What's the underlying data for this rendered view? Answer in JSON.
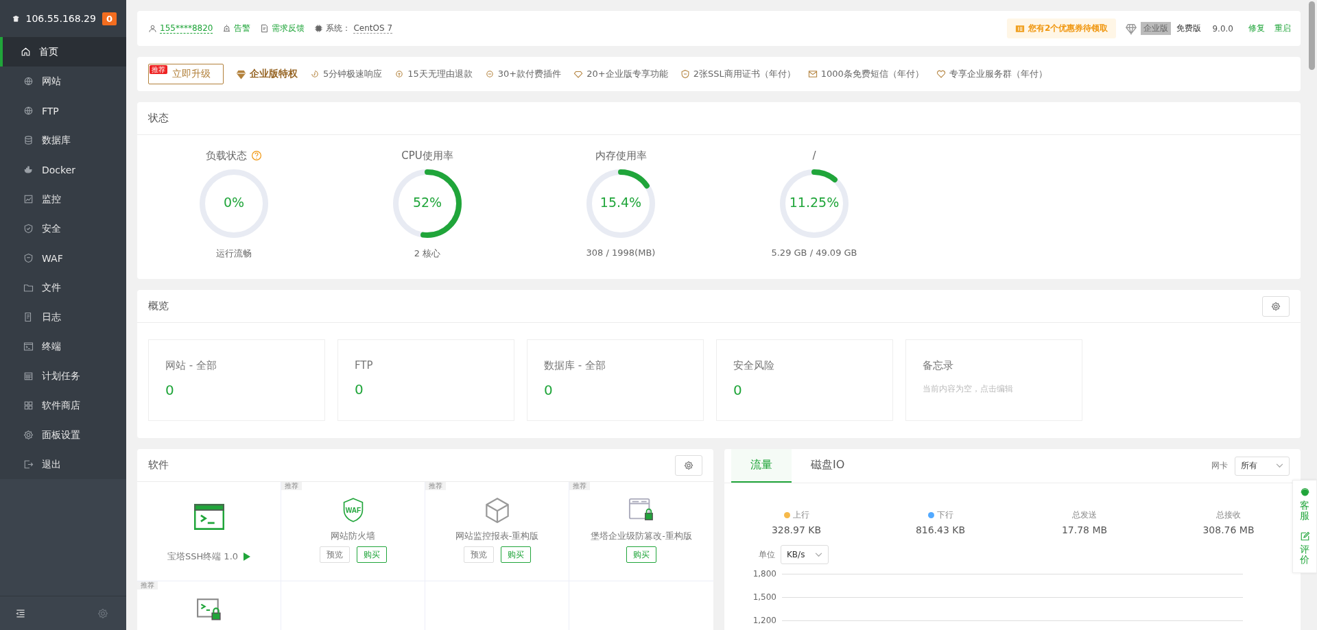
{
  "sidebar": {
    "host": "106.55.168.29",
    "badge": "0",
    "items": [
      {
        "label": "首页",
        "selected": true
      },
      {
        "label": "网站",
        "selected": false
      },
      {
        "label": "FTP",
        "selected": false
      },
      {
        "label": "数据库",
        "selected": false
      },
      {
        "label": "Docker",
        "selected": false
      },
      {
        "label": "监控",
        "selected": false
      },
      {
        "label": "安全",
        "selected": false
      },
      {
        "label": "WAF",
        "selected": false
      },
      {
        "label": "文件",
        "selected": false
      },
      {
        "label": "日志",
        "selected": false
      },
      {
        "label": "终端",
        "selected": false
      },
      {
        "label": "计划任务",
        "selected": false
      },
      {
        "label": "软件商店",
        "selected": false
      },
      {
        "label": "面板设置",
        "selected": false
      },
      {
        "label": "退出",
        "selected": false
      }
    ]
  },
  "topbar": {
    "left": [
      {
        "kind": "user",
        "text": "155****8820"
      },
      {
        "kind": "link",
        "text": "告警"
      },
      {
        "kind": "link",
        "text": "需求反馈"
      },
      {
        "kind": "system",
        "label": "系统：",
        "text": "CentOS 7"
      }
    ],
    "coupon": "您有2个优惠券待领取",
    "edition_tag": "企业版",
    "edition": "免费版",
    "version": "9.0.0",
    "actions": [
      "修复",
      "重启"
    ]
  },
  "features": {
    "upgrade": {
      "label": "立即升级",
      "ribbon": "推荐"
    },
    "title": "企业版特权",
    "items": [
      "5分钟极速响应",
      "15天无理由退款",
      "30+款付费插件",
      "20+企业版专享功能",
      "2张SSL商用证书（年付）",
      "1000条免费短信（年付）",
      "专享企业服务群（年付）"
    ]
  },
  "status": {
    "title": "状态",
    "gauges": [
      {
        "title": "负载状态",
        "help": true,
        "value": "0%",
        "level": 0,
        "caption": "运行流畅"
      },
      {
        "title": "CPU使用率",
        "help": false,
        "value": "52%",
        "level": 0.52,
        "caption": "2 核心"
      },
      {
        "title": "内存使用率",
        "help": false,
        "value": "15.4%",
        "level": 0.154,
        "caption": "308 / 1998(MB)"
      },
      {
        "title": "/",
        "help": false,
        "value": "11.25%",
        "level": 0.1125,
        "caption": "5.29 GB / 49.09 GB"
      }
    ]
  },
  "overview": {
    "title": "概览",
    "cards": [
      {
        "kind": "count",
        "label": "网站 - 全部",
        "value": "0"
      },
      {
        "kind": "count",
        "label": "FTP",
        "value": "0"
      },
      {
        "kind": "count",
        "label": "数据库 - 全部",
        "value": "0"
      },
      {
        "kind": "count",
        "label": "安全风险",
        "value": "0"
      },
      {
        "kind": "memo",
        "label": "备忘录",
        "value": "当前内容为空，点击编辑"
      }
    ]
  },
  "software": {
    "title": "软件",
    "tiles": [
      {
        "kind": "installed",
        "name": "宝塔SSH终端 1.0"
      },
      {
        "kind": "store",
        "tag": "推荐",
        "icon_text": "WAF",
        "name": "网站防火墙",
        "buttons": [
          {
            "kind": "preview",
            "label": "预览"
          },
          {
            "kind": "buy",
            "label": "购买"
          }
        ]
      },
      {
        "kind": "store",
        "tag": "推荐",
        "name": "网站监控报表-重构版",
        "buttons": [
          {
            "kind": "preview",
            "label": "预览"
          },
          {
            "kind": "buy",
            "label": "购买"
          }
        ]
      },
      {
        "kind": "store",
        "tag": "推荐",
        "name": "堡塔企业级防篡改-重构版",
        "buttons": [
          {
            "kind": "buy",
            "label": "购买"
          }
        ]
      },
      {
        "kind": "store",
        "tag": "推荐"
      },
      {
        "kind": "empty"
      },
      {
        "kind": "empty"
      },
      {
        "kind": "empty"
      }
    ]
  },
  "traffic": {
    "tabs": [
      {
        "label": "流量",
        "selected": true
      },
      {
        "label": "磁盘IO",
        "selected": false
      }
    ],
    "nic_label": "网卡",
    "nic_value": "所有",
    "stats": [
      {
        "label": "上行",
        "color": "#f6b94a",
        "value": "328.97 KB"
      },
      {
        "label": "下行",
        "color": "#52a9ff",
        "value": "816.43 KB"
      },
      {
        "label": "总发送",
        "value": "17.78 MB"
      },
      {
        "label": "总接收",
        "value": "308.76 MB"
      }
    ],
    "unit_label": "单位",
    "unit_value": "KB/s",
    "y_labels": [
      "1,800",
      "1,500",
      "1,200"
    ]
  },
  "float_panel": [
    "客服",
    "评价"
  ]
}
